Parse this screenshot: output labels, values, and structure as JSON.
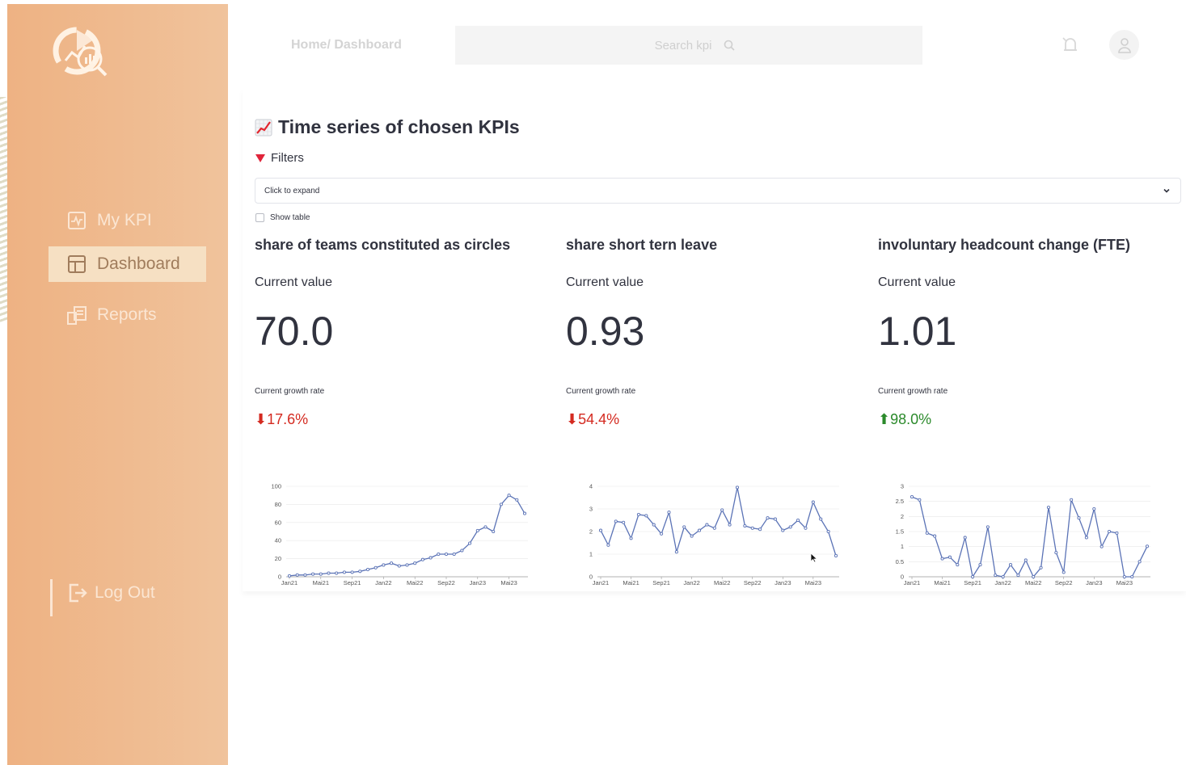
{
  "sidebar": {
    "items": [
      {
        "label": "My KPI",
        "icon": "kpi-icon"
      },
      {
        "label": "Dashboard",
        "icon": "dashboard-icon",
        "active": true
      },
      {
        "label": "Reports",
        "icon": "reports-icon"
      }
    ],
    "logout_label": "Log Out",
    "accent": "#eeb283"
  },
  "header": {
    "breadcrumb": "Home/ Dashboard",
    "search_placeholder": "Search kpi"
  },
  "main": {
    "title": "Time series of chosen KPIs",
    "filters_label": "Filters",
    "expander_label": "Click to expand",
    "show_table_label": "Show table"
  },
  "kpis": [
    {
      "title": "share of teams constituted as circles",
      "current_label": "Current value",
      "value": "70.0",
      "growth_label": "Current growth rate",
      "growth": "⬇17.6%",
      "direction": "down"
    },
    {
      "title": "share short tern leave",
      "current_label": "Current value",
      "value": "0.93",
      "growth_label": "Current growth rate",
      "growth": "⬇54.4%",
      "direction": "down"
    },
    {
      "title": "involuntary headcount change (FTE)",
      "current_label": "Current value",
      "value": "1.01",
      "growth_label": "Current growth rate",
      "growth": "⬆98.0%",
      "direction": "up"
    }
  ],
  "colors": {
    "down": "#d42a20",
    "up": "#2b8a2b",
    "line": "#5b73b6"
  },
  "chart_data": [
    {
      "type": "line",
      "x_ticks": [
        "Jan21",
        "Mai21",
        "Sep21",
        "Jan22",
        "Mai22",
        "Sep22",
        "Jan23",
        "Mai23"
      ],
      "ylim": [
        0,
        100
      ],
      "y_ticks": [
        0,
        20,
        40,
        60,
        80,
        100
      ],
      "grid": true,
      "values": [
        1,
        2,
        2,
        3,
        3,
        4,
        4,
        5,
        5,
        6,
        8,
        10,
        13,
        15,
        12,
        13,
        15,
        19,
        21,
        25,
        25,
        25,
        29,
        37,
        51,
        55,
        50,
        80,
        90,
        85,
        70
      ]
    },
    {
      "type": "line",
      "x_ticks": [
        "Jan21",
        "Mai21",
        "Sep21",
        "Jan22",
        "Mai22",
        "Sep22",
        "Jan23",
        "Mai23"
      ],
      "ylim": [
        0,
        4
      ],
      "y_ticks": [
        0,
        1,
        2,
        3,
        4
      ],
      "grid": true,
      "values": [
        2.05,
        1.4,
        2.45,
        2.4,
        1.7,
        2.75,
        2.7,
        2.3,
        1.9,
        2.85,
        1.1,
        2.2,
        1.8,
        2.05,
        2.3,
        2.15,
        2.95,
        2.3,
        3.95,
        2.25,
        2.15,
        2.1,
        2.6,
        2.55,
        2.05,
        2.2,
        2.5,
        2.15,
        3.3,
        2.55,
        2.0,
        0.93
      ]
    },
    {
      "type": "line",
      "x_ticks": [
        "Jan21",
        "Mai21",
        "Sep21",
        "Jan22",
        "Mai22",
        "Sep22",
        "Jan23",
        "Mai23"
      ],
      "ylim": [
        0,
        3
      ],
      "y_ticks": [
        0,
        0.5,
        1,
        1.5,
        2,
        2.5,
        3
      ],
      "grid": true,
      "values": [
        2.65,
        2.55,
        1.45,
        1.35,
        0.6,
        0.65,
        0.4,
        1.3,
        0.0,
        0.4,
        1.65,
        0.05,
        0.0,
        0.4,
        0.05,
        0.55,
        0.0,
        0.3,
        2.3,
        0.8,
        0.15,
        2.55,
        1.95,
        1.3,
        2.25,
        1.0,
        1.5,
        1.45,
        0.0,
        0.0,
        0.5,
        1.01
      ]
    }
  ]
}
